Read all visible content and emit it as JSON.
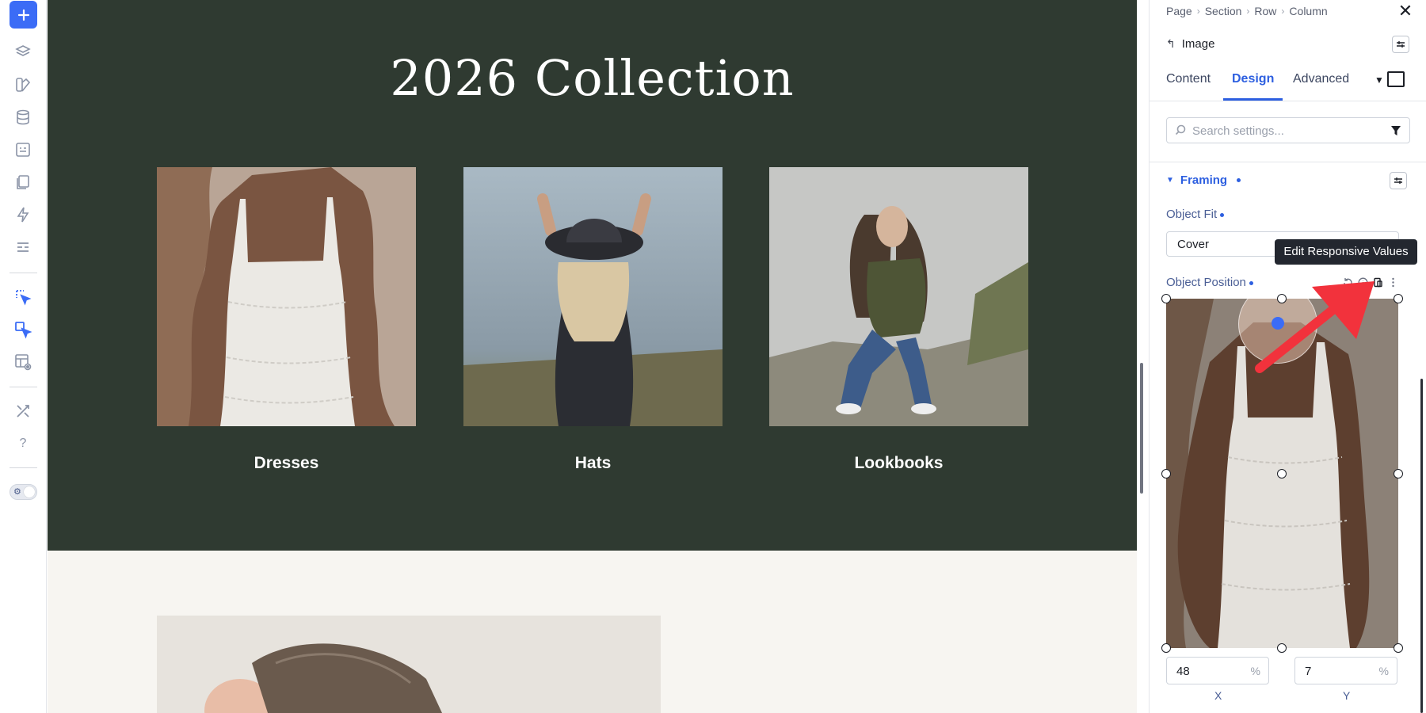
{
  "canvas": {
    "title": "2026 Collection",
    "cards": [
      {
        "label": "Dresses"
      },
      {
        "label": "Hats"
      },
      {
        "label": "Lookbooks"
      }
    ]
  },
  "panel": {
    "breadcrumb": [
      "Page",
      "Section",
      "Row",
      "Column"
    ],
    "element_title": "Image",
    "tabs": [
      "Content",
      "Design",
      "Advanced"
    ],
    "active_tab": "Design",
    "search_placeholder": "Search settings...",
    "section_title": "Framing",
    "object_fit": {
      "label": "Object Fit",
      "value": "Cover"
    },
    "tooltip": "Edit Responsive Values",
    "object_position": {
      "label": "Object Position",
      "x": {
        "value": "48",
        "unit": "%",
        "label": "X"
      },
      "y": {
        "value": "7",
        "unit": "%",
        "label": "Y"
      }
    }
  },
  "colors": {
    "accent": "#2d5fe0",
    "hero_bg": "#2f3a31",
    "add_button": "#3b6cf6",
    "annotation_arrow": "#f2323c"
  }
}
